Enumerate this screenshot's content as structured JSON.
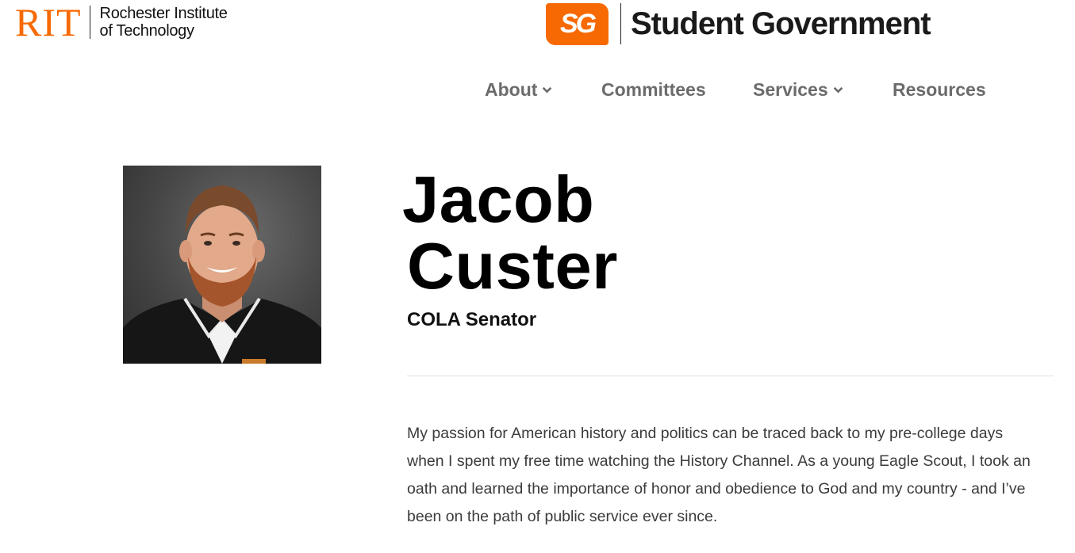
{
  "header": {
    "rit_mark": "RIT",
    "rit_name_line1": "Rochester Institute",
    "rit_name_line2": "of Technology",
    "sg_badge": "SG",
    "sg_title": "Student Government",
    "brand_color": "#f76902"
  },
  "nav": {
    "items": [
      {
        "label": "About",
        "has_dropdown": true
      },
      {
        "label": "Committees",
        "has_dropdown": false
      },
      {
        "label": "Services",
        "has_dropdown": true
      },
      {
        "label": "Resources",
        "has_dropdown": false
      }
    ],
    "color": "#6b6b6b"
  },
  "profile": {
    "first_name": "Jacob",
    "last_name": "Custer",
    "role": "COLA Senator",
    "bio": "My passion for American history and politics can be traced back to my pre-college days when I spent my free time watching the History Channel. As a young Eagle Scout, I took an oath and learned the importance of honor and obedience to God and my country - and I’ve been on the path of public service ever since."
  }
}
